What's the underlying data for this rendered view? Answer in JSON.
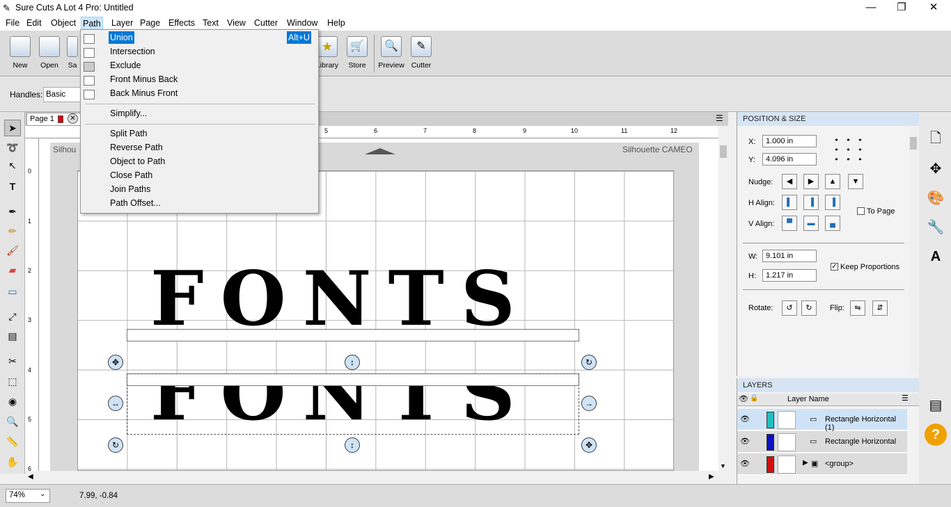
{
  "window": {
    "title": "Sure Cuts A Lot 4 Pro: Untitled",
    "minimize": "—",
    "maximize": "❐",
    "close": "✕"
  },
  "menubar": [
    "File",
    "Edit",
    "Object",
    "Path",
    "Layer",
    "Page",
    "Effects",
    "Text",
    "View",
    "Cutter",
    "Window",
    "Help"
  ],
  "toolbar": {
    "new": "New",
    "open": "Open",
    "save": "Sa",
    "library": "Library",
    "store": "Store",
    "preview": "Preview",
    "cutter": "Cutter"
  },
  "handles": {
    "label": "Handles:",
    "value": "Basic"
  },
  "page_tab": {
    "label": "Page 1"
  },
  "ruler_top": [
    "5",
    "6",
    "7",
    "8",
    "9",
    "10",
    "11",
    "12"
  ],
  "ruler_left": [
    "0",
    "1",
    "2",
    "3",
    "4",
    "5",
    "6"
  ],
  "canvas": {
    "left_label": "Silhou",
    "right_label": "Silhouette CAMEO",
    "text_top": "FONTS",
    "text_bottom": "FONTS"
  },
  "path_menu": {
    "items": [
      {
        "label": "Union",
        "shortcut": "Alt+U"
      },
      {
        "label": "Intersection"
      },
      {
        "label": "Exclude"
      },
      {
        "label": "Front Minus Back"
      },
      {
        "label": "Back Minus Front"
      },
      {
        "label": "Simplify..."
      },
      {
        "label": "Split Path"
      },
      {
        "label": "Reverse Path"
      },
      {
        "label": "Object to Path"
      },
      {
        "label": "Close Path"
      },
      {
        "label": "Join Paths"
      },
      {
        "label": "Path Offset..."
      }
    ]
  },
  "position_size": {
    "title": "POSITION & SIZE",
    "x_label": "X:",
    "x": "1.000 in",
    "y_label": "Y:",
    "y": "4.096 in",
    "nudge": "Nudge:",
    "halign": "H Align:",
    "valign": "V Align:",
    "to_page": "To Page",
    "w_label": "W:",
    "w": "9.101 in",
    "h_label": "H:",
    "h": "1.217 in",
    "keep": "Keep Proportions",
    "rotate": "Rotate:",
    "flip": "Flip:"
  },
  "layers": {
    "title": "LAYERS",
    "col": "Layer Name",
    "rows": [
      {
        "name": "Rectangle Horizontal (1)",
        "color": "#20c0c0"
      },
      {
        "name": "Rectangle Horizontal",
        "color": "#1010c0"
      },
      {
        "name": "<group>",
        "color": "#d01010"
      }
    ]
  },
  "status": {
    "zoom": "74%",
    "coords": "7.99, -0.84"
  }
}
